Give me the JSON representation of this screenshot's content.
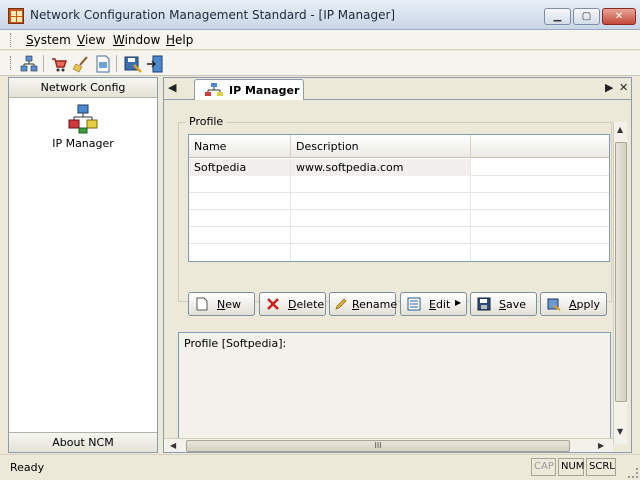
{
  "window": {
    "title": "Network Configuration Management Standard - [IP Manager]",
    "min_symbol": "▁",
    "max_symbol": "▢",
    "close_symbol": "✕"
  },
  "menu": {
    "items": [
      {
        "first": "S",
        "rest": "ystem"
      },
      {
        "first": "V",
        "rest": "iew"
      },
      {
        "first": "W",
        "rest": "indow"
      },
      {
        "first": "H",
        "rest": "elp"
      }
    ]
  },
  "left_panel": {
    "header": "Network Config",
    "item_label": "IP Manager",
    "footer": "About NCM"
  },
  "tab": {
    "label": "IP Manager",
    "prev_symbol": "◀",
    "next_symbol": "▶",
    "close_symbol": "✕"
  },
  "profile": {
    "group_title": "Profile",
    "columns": [
      "Name",
      "Description"
    ],
    "rows": [
      [
        "Softpedia",
        "www.softpedia.com"
      ]
    ]
  },
  "buttons": {
    "new": {
      "first": "N",
      "rest": "ew"
    },
    "delete": {
      "first": "D",
      "rest": "elete"
    },
    "rename": {
      "first": "R",
      "rest": "ename"
    },
    "edit": {
      "first": "E",
      "rest": "dit"
    },
    "save": {
      "first": "S",
      "rest": "ave"
    },
    "apply": {
      "first": "A",
      "rest": "pply"
    },
    "edit_arrow": "▶"
  },
  "log": {
    "text": "Profile [Softpedia]:"
  },
  "scroll": {
    "up": "▲",
    "down": "▼",
    "left": "◀",
    "right": "▶",
    "grip": "III"
  },
  "status": {
    "text": "Ready",
    "indicators": [
      "CAP",
      "NUM",
      "SCRL"
    ]
  },
  "colors": {
    "accent": "#C8561E",
    "selection": "#F1F0EC",
    "border": "#8E9BAE"
  },
  "icons": {
    "toolbar": [
      "network-icon",
      "cart-icon",
      "broom-icon",
      "document-icon",
      "save-config-icon",
      "exit-icon"
    ]
  }
}
